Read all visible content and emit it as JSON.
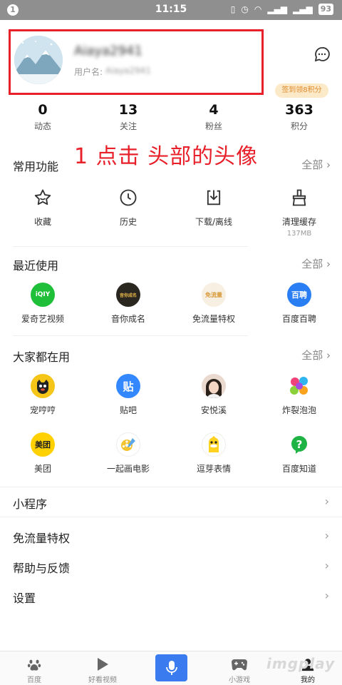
{
  "status_bar": {
    "notification": "1",
    "time": "11:15",
    "battery": "93"
  },
  "profile": {
    "username": "Aiaya2941",
    "user_id_label": "用户名:",
    "user_id_value": "Aiaya2941",
    "checkin_badge": "签到领8积分",
    "highlight_color": "#e8202a"
  },
  "stats": [
    {
      "value": "0",
      "label": "动态"
    },
    {
      "value": "13",
      "label": "关注"
    },
    {
      "value": "4",
      "label": "粉丝"
    },
    {
      "value": "363",
      "label": "积分"
    }
  ],
  "annotation": "1 点击 头部的头像",
  "common_functions": {
    "title": "常用功能",
    "more": "全部 ›",
    "items": [
      {
        "label": "收藏",
        "icon": "star-icon"
      },
      {
        "label": "历史",
        "icon": "clock-icon"
      },
      {
        "label": "下载/离线",
        "icon": "download-icon"
      },
      {
        "label": "清理缓存",
        "sub": "137MB",
        "icon": "broom-icon"
      }
    ]
  },
  "recent": {
    "title": "最近使用",
    "more": "全部 ›",
    "items": [
      {
        "label": "爱奇艺视频",
        "icon": "iqiyi-icon",
        "badge": "iQIY"
      },
      {
        "label": "音你成名",
        "icon": "yinni-icon",
        "badge": "音你成名"
      },
      {
        "label": "免流量特权",
        "icon": "free-data-icon",
        "badge": "免流量"
      },
      {
        "label": "百度百聘",
        "icon": "baipin-icon",
        "badge": "百聘"
      }
    ]
  },
  "popular": {
    "title": "大家都在用",
    "more": "全部 ›",
    "row1": [
      {
        "label": "宠哼哼",
        "icon": "chonghengheng-icon"
      },
      {
        "label": "贴吧",
        "icon": "tieba-icon",
        "badge": "贴"
      },
      {
        "label": "安悦溪",
        "icon": "anyuexi-icon"
      },
      {
        "label": "炸裂泡泡",
        "icon": "bubble-icon"
      }
    ],
    "row2": [
      {
        "label": "美团",
        "icon": "meituan-icon",
        "badge": "美团"
      },
      {
        "label": "一起画电影",
        "icon": "film-icon"
      },
      {
        "label": "逗芽表情",
        "icon": "douya-icon"
      },
      {
        "label": "百度知道",
        "icon": "zhidao-icon",
        "badge": "?"
      }
    ]
  },
  "list_items": [
    {
      "label": "小程序",
      "chevron": "›"
    },
    {
      "label": "免流量特权",
      "chevron": "›"
    },
    {
      "label": "帮助与反馈",
      "chevron": "›"
    },
    {
      "label": "设置",
      "chevron": "›"
    }
  ],
  "bottom_nav": [
    {
      "label": "百度",
      "icon": "paw-icon"
    },
    {
      "label": "好看视频",
      "icon": "play-icon"
    },
    {
      "label": "",
      "icon": "mic-icon"
    },
    {
      "label": "小游戏",
      "icon": "gamepad-icon"
    },
    {
      "label": "我的",
      "icon": "user-icon"
    }
  ],
  "watermark": "imgplay"
}
